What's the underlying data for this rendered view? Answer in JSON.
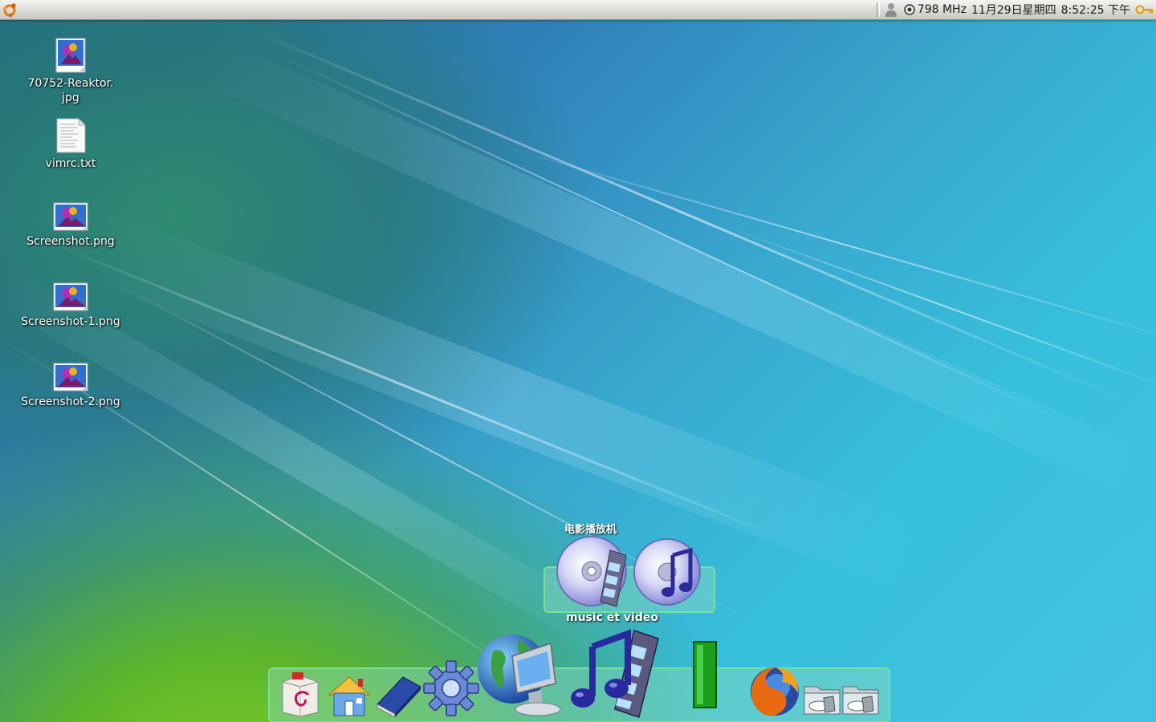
{
  "top_panel": {
    "menu_icon": "ubuntu-logo-icon",
    "tray": {
      "user_icon": "user-icon",
      "cpu_icon": "cpu-gauge-icon",
      "cpu_freq": "798 MHz",
      "date": "11月29日星期四",
      "time": "8:52:25 下午",
      "keys_icon": "keys-icon"
    }
  },
  "desktop_icons": [
    {
      "label": "70752-Reaktor.\njpg",
      "icon": "image-file-icon"
    },
    {
      "label": "vimrc.txt",
      "icon": "text-file-icon"
    },
    {
      "label": "Screenshot.png",
      "icon": "image-file-icon"
    },
    {
      "label": "Screenshot-1.png",
      "icon": "image-file-icon"
    },
    {
      "label": "Screenshot-2.png",
      "icon": "image-file-icon"
    }
  ],
  "dock": {
    "stack": {
      "title": "电影播放机",
      "name": "music et video",
      "items": [
        "movie-player-disc-icon",
        "music-disc-icon"
      ]
    },
    "items": [
      "debian-package-icon",
      "home-folder-icon",
      "book-icon",
      "gear-icon",
      "network-computer-icon",
      "music-video-icon",
      "green-bar-icon",
      "firefox-icon",
      "drive-folder-icon",
      "drive-folder-icon"
    ]
  }
}
